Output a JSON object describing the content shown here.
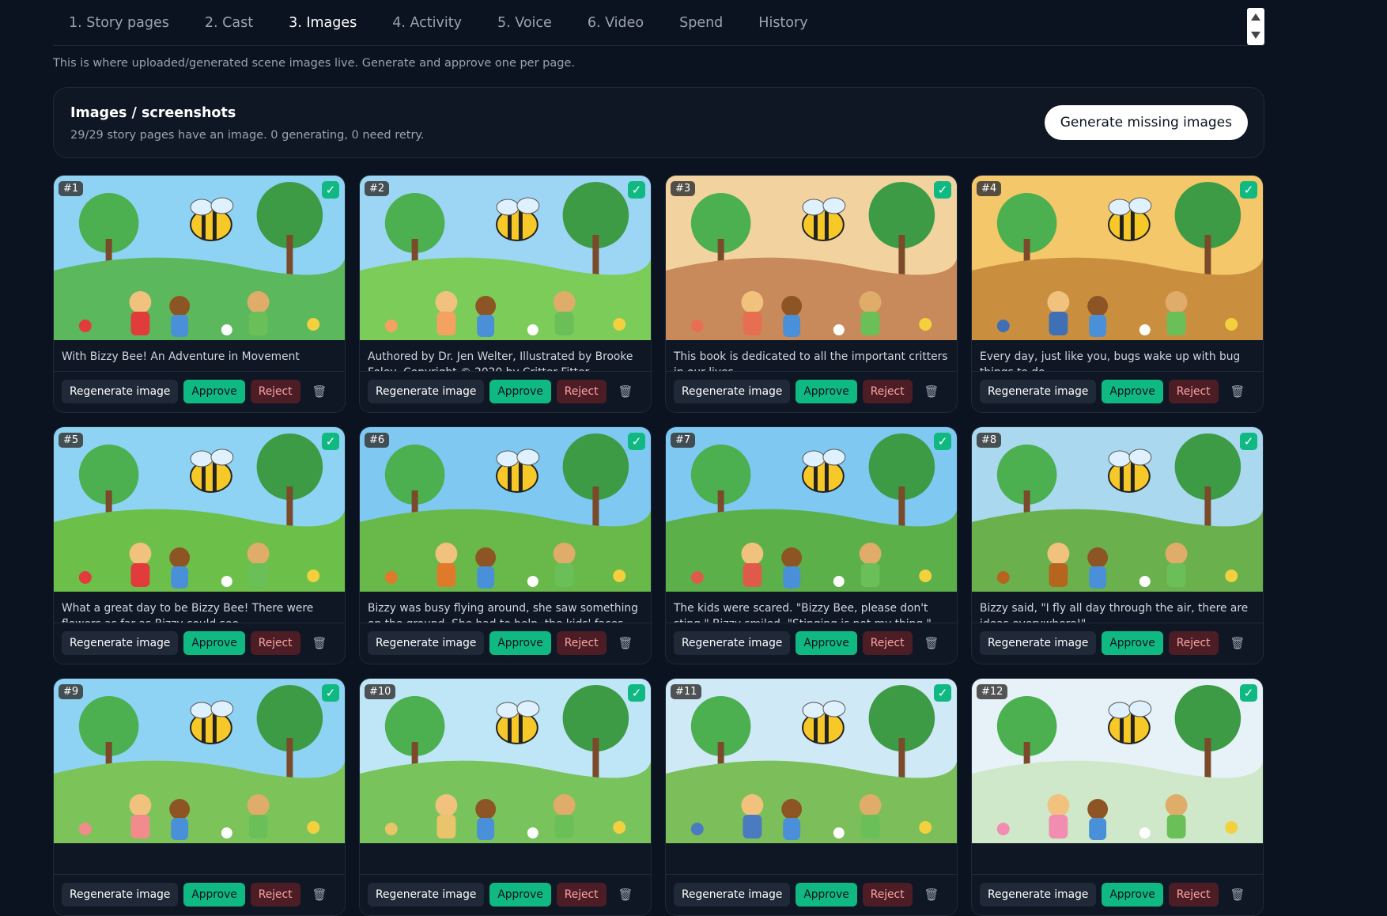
{
  "tabs": [
    "1. Story pages",
    "2. Cast",
    "3. Images",
    "4. Activity",
    "5. Voice",
    "6. Video",
    "Spend",
    "History"
  ],
  "active_tab": "3. Images",
  "description": "This is where uploaded/generated scene images live. Generate and approve one per page.",
  "panel": {
    "title": "Images / screenshots",
    "subtitle": "29/29 story pages have an image. 0 generating, 0 need retry.",
    "generate_button": "Generate missing images"
  },
  "card_actions": {
    "regenerate": "Regenerate image",
    "approve": "Approve",
    "reject": "Reject",
    "trash_icon": "🗑",
    "check_icon": "✓"
  },
  "cards": [
    {
      "num": "#1",
      "caption": "With Bizzy Bee! An Adventure in Movement"
    },
    {
      "num": "#2",
      "caption": "Authored by Dr. Jen Welter, Illustrated by Brooke Foley, Copyright © 2020 by Critter Fitter Publishing"
    },
    {
      "num": "#3",
      "caption": "This book is dedicated to all the important critters in our lives."
    },
    {
      "num": "#4",
      "caption": "Every day, just like you, bugs wake up with bug things to do."
    },
    {
      "num": "#5",
      "caption": "What a great day to be Bizzy Bee! There were flowers as far as Bizzy could see."
    },
    {
      "num": "#6",
      "caption": "Bizzy was busy flying around, she saw something on the ground. She had to help, the kids' faces had..."
    },
    {
      "num": "#7",
      "caption": "The kids were scared. \"Bizzy Bee, please don't sting.\" Bizzy smiled. \"Stinging is not my thing.\""
    },
    {
      "num": "#8",
      "caption": "Bizzy said, \"I fly all day through the air, there are ideas everywhere!\""
    },
    {
      "num": "#9",
      "caption": ""
    },
    {
      "num": "#10",
      "caption": ""
    },
    {
      "num": "#11",
      "caption": ""
    },
    {
      "num": "#12",
      "caption": ""
    }
  ],
  "colors": {
    "background": "#0b1220",
    "approve": "#10b981",
    "reject_bg": "#4c1d25",
    "reject_text": "#fca5a5"
  }
}
